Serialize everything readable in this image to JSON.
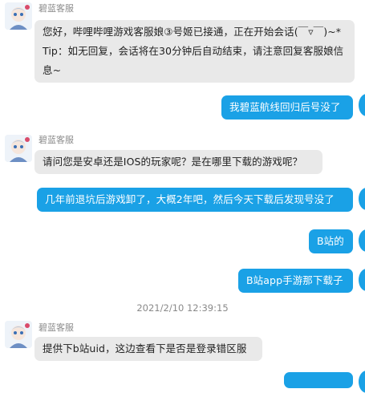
{
  "agent": {
    "name": "碧蓝客服"
  },
  "messages": [
    {
      "side": "in",
      "text": "您好，哔哩哔哩游戏客服娘③号姬已接通，正在开始会话(￣▿￣)~*　Tip：如无回复，会话将在30分钟后自动结束，请注意回复客服娘信息~"
    },
    {
      "side": "out",
      "text": "我碧蓝航线回归后号没了"
    },
    {
      "side": "in",
      "text": "请问您是安卓还是IOS的玩家呢？是在哪里下载的游戏呢？"
    },
    {
      "side": "out",
      "text": "几年前退坑后游戏卸了，大概2年吧，然后今天下载后发现号没了"
    },
    {
      "side": "out",
      "text": "B站的"
    },
    {
      "side": "out",
      "text": "B站app手游那下载子"
    },
    {
      "side": "in",
      "text": "提供下b站uid，这边查看下是否是登录错区服"
    }
  ],
  "timestamp": "2021/2/10 12:39:15",
  "colors": {
    "outgoing": "#1aa1e6",
    "incoming": "#e9e9e9"
  }
}
